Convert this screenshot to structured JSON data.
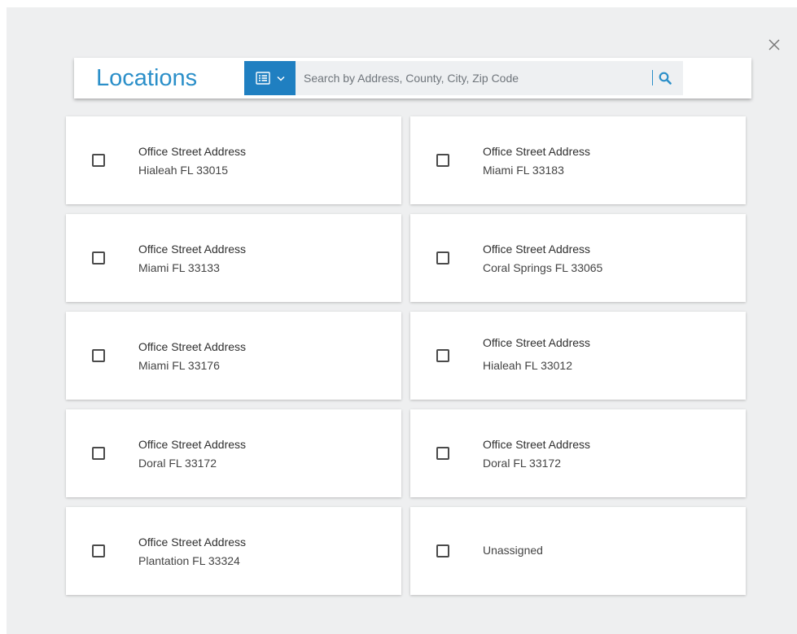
{
  "header": {
    "title": "Locations",
    "search_placeholder": "Search by Address, County, City, Zip Code"
  },
  "icons": {
    "close": "close-icon",
    "view_toggle": "list-icon",
    "view_toggle_caret": "chevron-down-icon",
    "search": "search-icon"
  },
  "colors": {
    "accent": "#2b8fc9",
    "toggle_bg": "#1f7fc1",
    "modal_bg": "#eeeff0"
  },
  "locations": [
    {
      "line1": "Office Street Address",
      "line2": "Hialeah FL 33015"
    },
    {
      "line1": "Office Street Address",
      "line2": "Miami FL 33183"
    },
    {
      "line1": "Office Street Address",
      "line2": "Miami FL 33133"
    },
    {
      "line1": "Office Street Address",
      "line2": "Coral Springs FL 33065"
    },
    {
      "line1": "Office Street Address",
      "line2": "Miami FL 33176"
    },
    {
      "line1": "Office Street Address",
      "line2": "Hialeah FL 33012"
    },
    {
      "line1": "Office Street Address",
      "line2": "Doral FL 33172"
    },
    {
      "line1": "Office Street Address",
      "line2": "Doral FL 33172"
    },
    {
      "line1": "Office Street Address",
      "line2": "Plantation FL 33324"
    },
    {
      "label": "Unassigned"
    }
  ]
}
